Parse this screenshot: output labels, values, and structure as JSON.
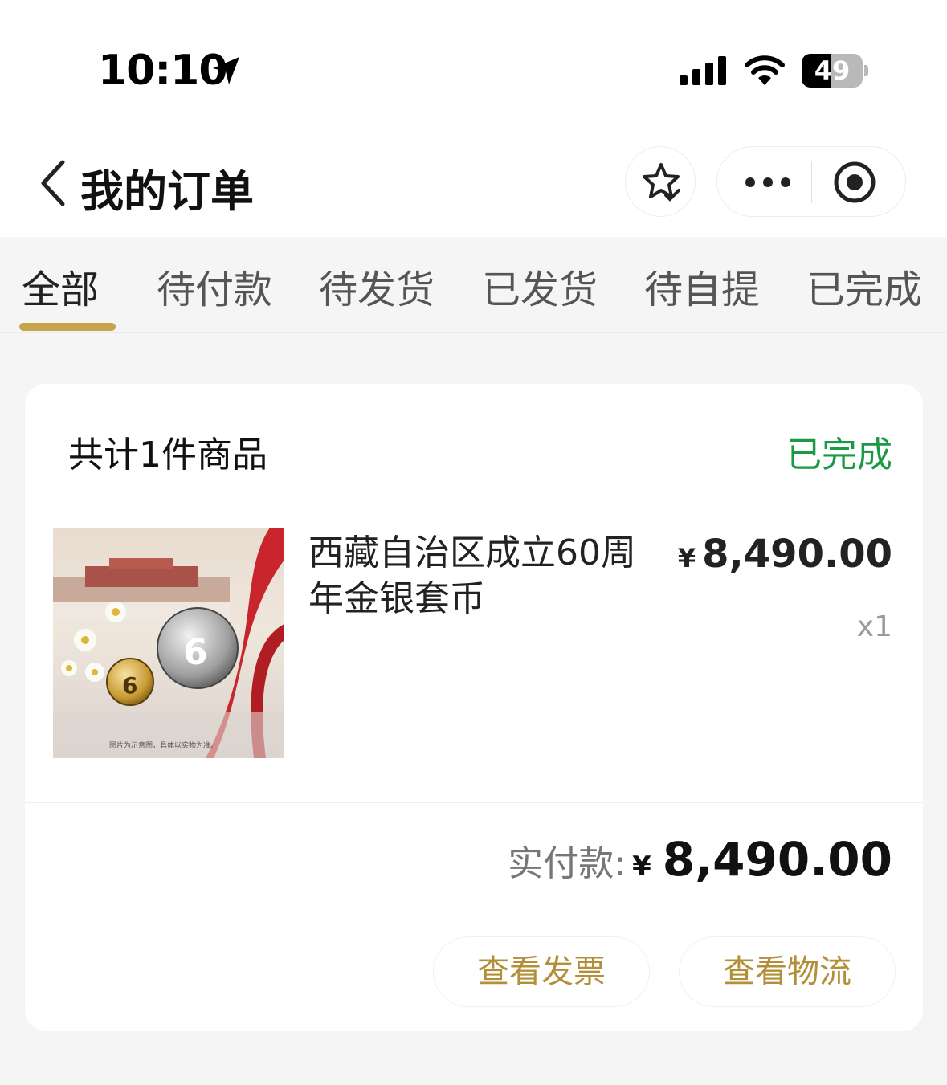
{
  "status_bar": {
    "time": "10:10",
    "battery_level": "49",
    "battery_fraction": 0.49
  },
  "nav": {
    "title": "我的订单"
  },
  "tabs": [
    {
      "label": "全部",
      "active": true
    },
    {
      "label": "待付款",
      "active": false
    },
    {
      "label": "待发货",
      "active": false
    },
    {
      "label": "已发货",
      "active": false
    },
    {
      "label": "待自提",
      "active": false
    },
    {
      "label": "已完成",
      "active": false
    }
  ],
  "order": {
    "count_label": "共计1件商品",
    "status": "已完成",
    "product": {
      "name": "西藏自治区成立60周年金银套币",
      "currency": "¥",
      "price": "8,490.00",
      "quantity": "x1",
      "image_caption": "图片为示意图，具体以实物为准。"
    },
    "paid_label": "实付款:",
    "paid_currency": "¥",
    "paid_amount": "8,490.00",
    "actions": {
      "invoice": "查看发票",
      "logistics": "查看物流"
    }
  },
  "colors": {
    "accent_gold": "#c8a44d",
    "action_text": "#b38f3a",
    "status_green": "#1b9a45",
    "background": "#f5f5f5"
  }
}
